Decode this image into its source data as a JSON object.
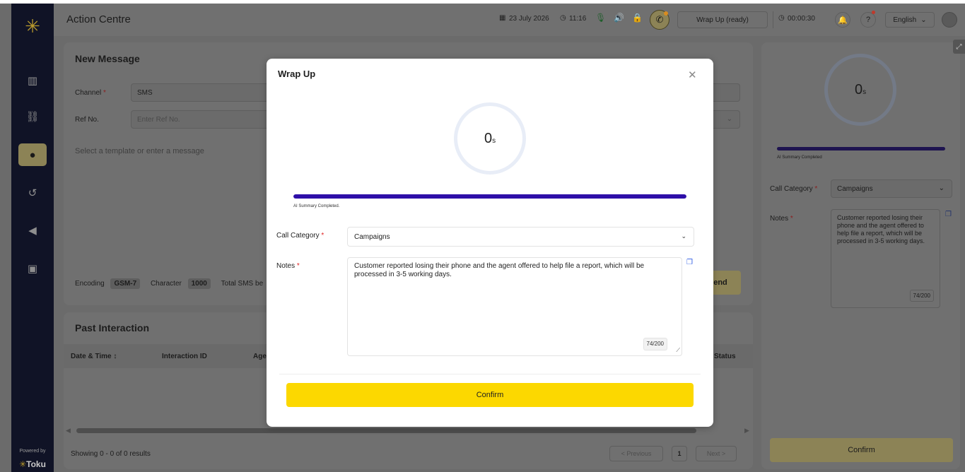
{
  "header": {
    "title": "Action Centre",
    "date": "23 July 2026",
    "time": "11:16",
    "status": "Wrap Up (ready)",
    "timer": "00:00:30",
    "language": "English"
  },
  "sidebar": {
    "powered_by": "Powered by",
    "brand": "Toku"
  },
  "new_message": {
    "title": "New Message",
    "channel_label": "Channel",
    "channel_value": "SMS",
    "ref_label": "Ref No.",
    "ref_placeholder": "Enter Ref No.",
    "message_placeholder": "Select a template or enter a message",
    "encoding_label": "Encoding",
    "encoding_value": "GSM-7",
    "character_label": "Character",
    "character_value": "1000",
    "total_sms_label": "Total SMS be",
    "send_label": "end"
  },
  "past_interaction": {
    "title": "Past Interaction",
    "columns": [
      "Date & Time",
      "Interaction ID",
      "Age",
      "Status"
    ],
    "showing": "Showing 0 - 0 of 0 results",
    "prev": "< Previous",
    "page": "1",
    "next": "Next >"
  },
  "right_panel": {
    "timer_value": "0",
    "timer_unit": "s",
    "ai_summary": "AI Summary Completed",
    "call_category_label": "Call Category",
    "call_category_value": "Campaigns",
    "notes_label": "Notes",
    "notes_value": "Customer reported losing their phone and the agent offered to help file a report, which will be processed in 3-5 working days.",
    "notes_counter": "74/200",
    "confirm": "Confirm"
  },
  "modal": {
    "title": "Wrap Up",
    "timer_value": "0",
    "timer_unit": "s",
    "progress": 1.0,
    "ai_summary": "AI Summary Completed.",
    "call_category_label": "Call Category",
    "call_category_value": "Campaigns",
    "notes_label": "Notes",
    "notes_value": "Customer reported losing their phone and the agent offered to help file a report, which will be processed in 3-5 working days.",
    "notes_counter": "74/200",
    "confirm": "Confirm"
  },
  "colors": {
    "accent": "#fcd800",
    "progress": "#2e0fa8",
    "sidebar": "#101326"
  }
}
